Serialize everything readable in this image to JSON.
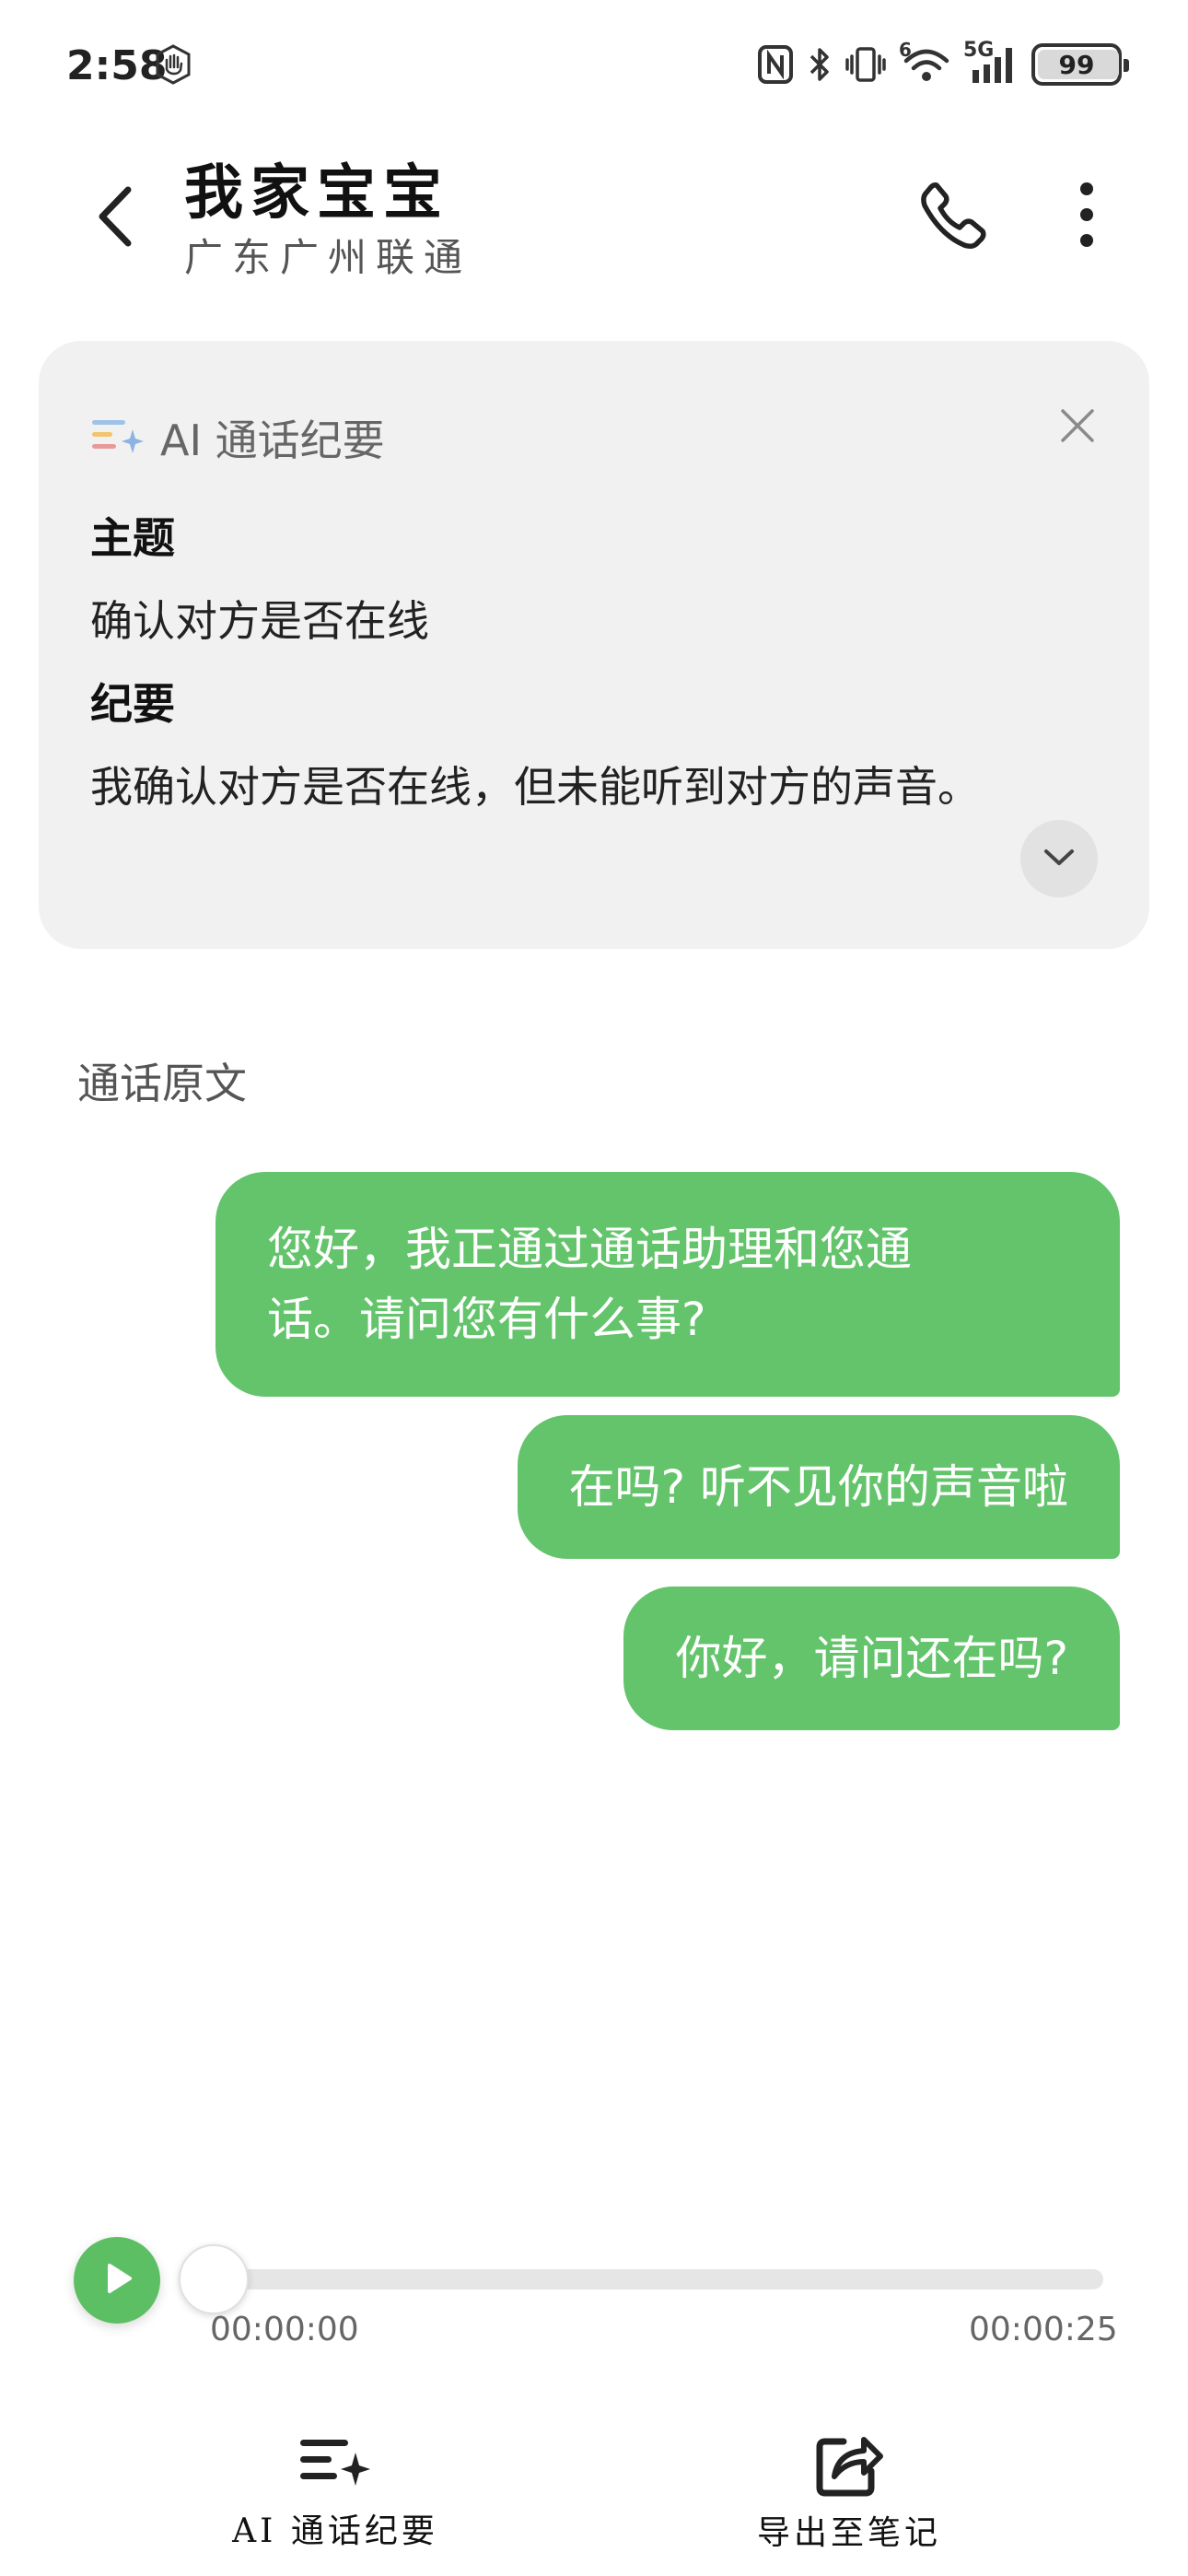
{
  "status_bar": {
    "time": "2:58",
    "network": "5G",
    "sim_slot": "6",
    "battery": "99",
    "icons": [
      "hand-icon",
      "nfc-icon",
      "bluetooth-icon",
      "vibrate-icon",
      "wifi-icon",
      "signal-icon",
      "battery-icon"
    ]
  },
  "header": {
    "contact_name": "我家宝宝",
    "contact_location": "广东广州联通",
    "icons": [
      "back-arrow-icon",
      "phone-icon",
      "more-vertical-icon"
    ]
  },
  "summary": {
    "title": "AI 通话纪要",
    "topic_label": "主题",
    "topic_text": "确认对方是否在线",
    "notes_label": "纪要",
    "notes_text": "我确认对方是否在线，但未能听到对方的声音。",
    "icons": [
      "ai-sparkle-icon",
      "close-icon",
      "chevron-down-icon"
    ]
  },
  "transcript": {
    "title": "通话原文",
    "messages": [
      {
        "text_line1": "您好，我正通过通话助理和您通",
        "text_line2": "话。请问您有什么事?"
      },
      {
        "text": "在吗? 听不见你的声音啦"
      },
      {
        "text": "你好，请问还在吗?"
      }
    ],
    "bubble_color": "#63c46b"
  },
  "player": {
    "current_time": "00:00:00",
    "total_time": "00:00:25",
    "progress": 0,
    "accent_color": "#5dbf64",
    "icons": [
      "play-icon"
    ]
  },
  "bottom_actions": [
    {
      "label": "AI 通话纪要",
      "icon": "ai-summary-icon"
    },
    {
      "label": "导出至笔记",
      "icon": "export-share-icon"
    }
  ]
}
